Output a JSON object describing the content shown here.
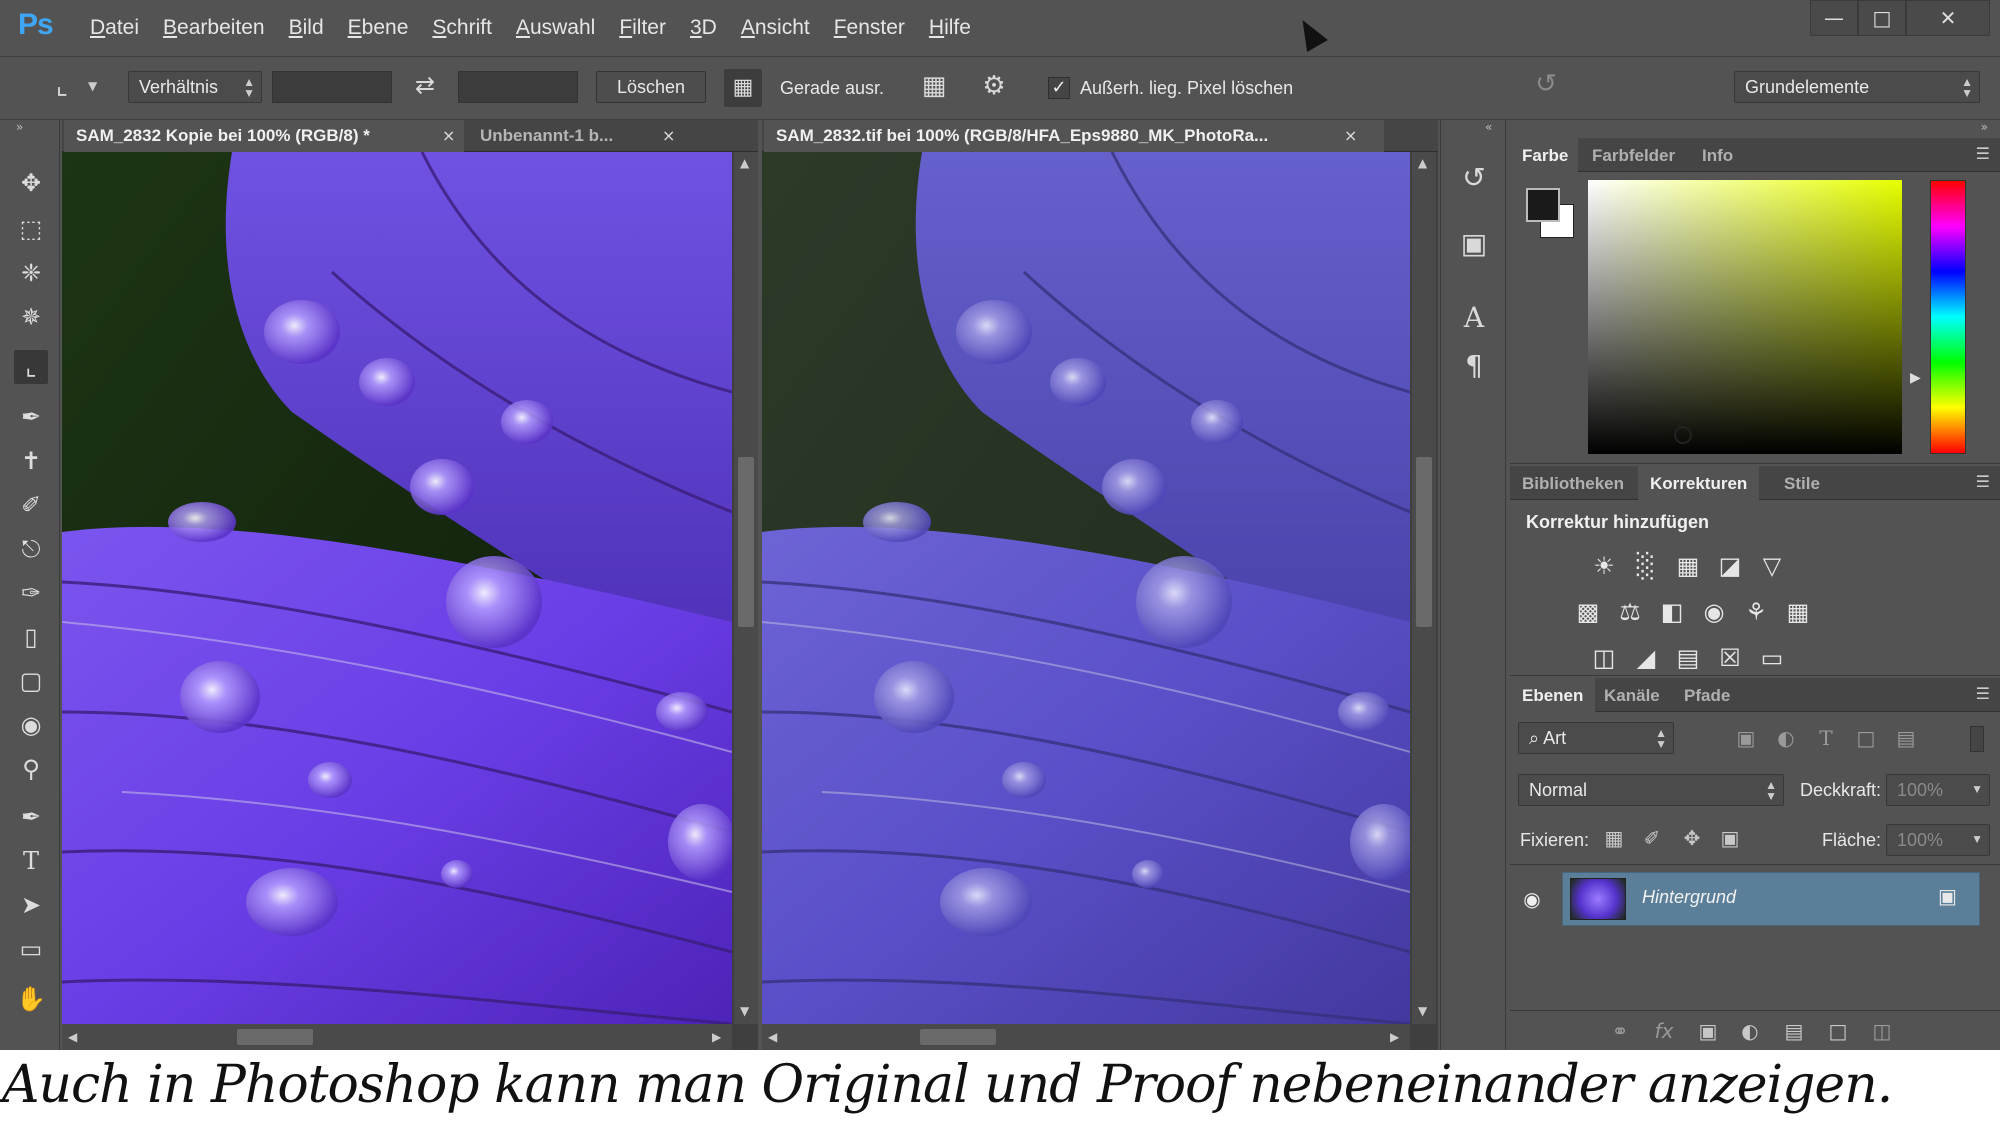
{
  "app": {
    "logo": "Ps",
    "menu": [
      "Datei",
      "Bearbeiten",
      "Bild",
      "Ebene",
      "Schrift",
      "Auswahl",
      "Filter",
      "3D",
      "Ansicht",
      "Fenster",
      "Hilfe"
    ]
  },
  "options": {
    "ratio_dropdown": "Verhältnis",
    "delete_button": "Löschen",
    "straighten_label": "Gerade ausr.",
    "delete_pixels_label": "Außerh. lieg. Pixel löschen",
    "delete_pixels_checked": true,
    "workspace_dropdown": "Grundelemente"
  },
  "documents": {
    "left": {
      "tabs": [
        "SAM_2832 Kopie bei 100% (RGB/8) *",
        "Unbenannt-1 b..."
      ],
      "active_tab": 0
    },
    "right": {
      "tabs": [
        "SAM_2832.tif bei 100% (RGB/8/HFA_Eps9880_MK_PhotoRa..."
      ],
      "active_tab": 0
    }
  },
  "color_panel": {
    "tabs": [
      "Farbe",
      "Farbfelder",
      "Info"
    ],
    "active_tab": 0,
    "foreground_color": "#1a1a1a",
    "background_color": "#ffffff"
  },
  "adjustments_panel": {
    "tabs": [
      "Bibliotheken",
      "Korrekturen",
      "Stile"
    ],
    "active_tab": 1,
    "heading": "Korrektur hinzufügen"
  },
  "layers_panel": {
    "tabs": [
      "Ebenen",
      "Kanäle",
      "Pfade"
    ],
    "active_tab": 0,
    "filter_dropdown": "Art",
    "blend_mode": "Normal",
    "opacity_label": "Deckkraft:",
    "opacity_value": "100%",
    "lock_label": "Fixieren:",
    "fill_label": "Fläche:",
    "fill_value": "100%",
    "layers": [
      {
        "name": "Hintergrund",
        "visible": true,
        "locked": true
      }
    ]
  },
  "caption": "Auch in Photoshop kann man Original und Proof nebeneinander anzeigen.",
  "colors": {
    "ui_bg": "#535353",
    "selected_layer": "#5b7f99",
    "logo_blue": "#3fa6f5",
    "petal_original": "#6a3ee6",
    "petal_proof": "#5a4fc8"
  }
}
